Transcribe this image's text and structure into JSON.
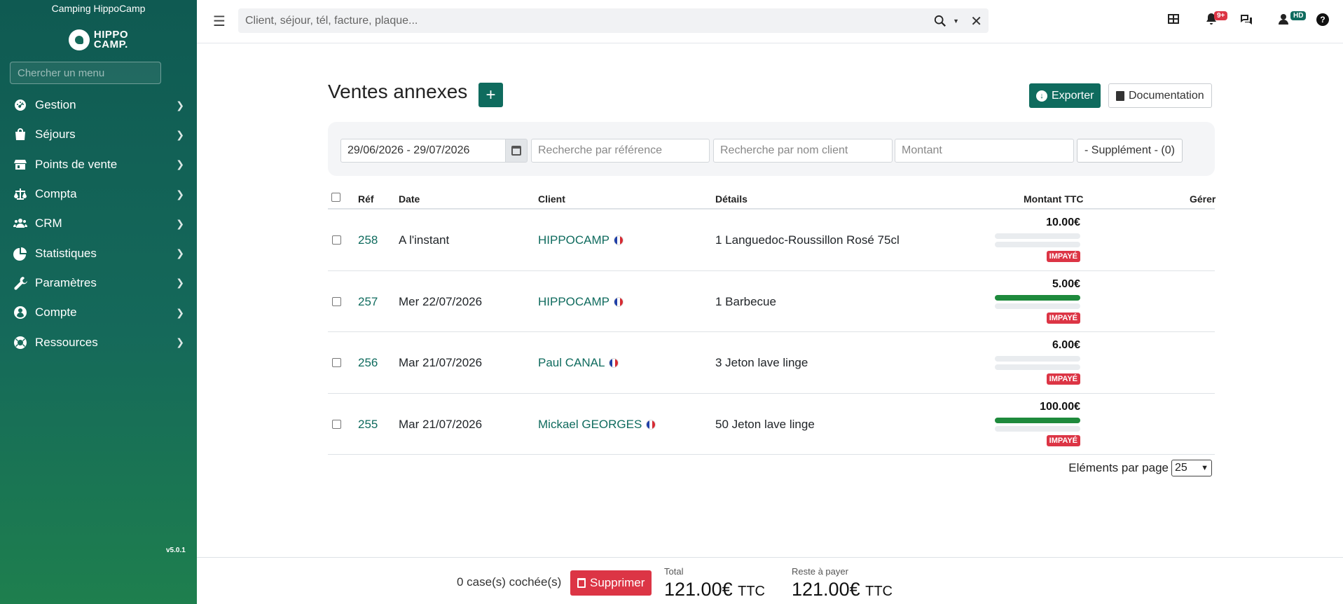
{
  "sidebar": {
    "camp_name": "Camping HippoCamp",
    "logo_text_1": "HIPPO",
    "logo_text_2": "CAMP.",
    "search_placeholder": "Chercher un menu",
    "items": [
      {
        "label": "Gestion",
        "icon": "gauge-icon"
      },
      {
        "label": "Séjours",
        "icon": "bag-icon"
      },
      {
        "label": "Points de vente",
        "icon": "store-icon"
      },
      {
        "label": "Compta",
        "icon": "scale-icon"
      },
      {
        "label": "CRM",
        "icon": "users-icon"
      },
      {
        "label": "Statistiques",
        "icon": "pie-chart-icon"
      },
      {
        "label": "Paramètres",
        "icon": "wrench-icon"
      },
      {
        "label": "Compte",
        "icon": "user-circle-icon"
      },
      {
        "label": "Ressources",
        "icon": "lifebuoy-icon"
      }
    ],
    "version": "v5.0.1"
  },
  "topbar": {
    "search_placeholder": "Client, séjour, tél, facture, plaque...",
    "notifications_badge": "9+",
    "user_initials": "HD",
    "help": "?"
  },
  "page": {
    "title": "Ventes annexes",
    "add_label": "+",
    "export_label": "Exporter",
    "documentation_label": "Documentation"
  },
  "filters": {
    "date_range": "29/06/2026 - 29/07/2026",
    "ref_placeholder": "Recherche par référence",
    "client_placeholder": "Recherche par nom client",
    "amount_placeholder": "Montant",
    "supplement_label": "- Supplément - (0)"
  },
  "table": {
    "headers": {
      "ref": "Réf",
      "date": "Date",
      "client": "Client",
      "details": "Détails",
      "amount": "Montant TTC",
      "manage": "Gérer"
    },
    "rows": [
      {
        "ref": "258",
        "date": "A l'instant",
        "client": "HIPPOCAMP",
        "details": "1 Languedoc-Roussillon Rosé 75cl",
        "amount": "10.00€",
        "paid_fraction": 0,
        "status": "IMPAYÉ"
      },
      {
        "ref": "257",
        "date": "Mer 22/07/2026",
        "client": "HIPPOCAMP",
        "details": "1 Barbecue",
        "amount": "5.00€",
        "paid_fraction": 1,
        "status": "IMPAYÉ"
      },
      {
        "ref": "256",
        "date": "Mar 21/07/2026",
        "client": "Paul CANAL",
        "details": "3 Jeton lave linge",
        "amount": "6.00€",
        "paid_fraction": 0,
        "status": "IMPAYÉ"
      },
      {
        "ref": "255",
        "date": "Mar 21/07/2026",
        "client": "Mickael GEORGES",
        "details": "50 Jeton lave linge",
        "amount": "100.00€",
        "paid_fraction": 1,
        "status": "IMPAYÉ"
      }
    ],
    "per_page_label": "Eléments par page",
    "per_page_value": "25"
  },
  "footer": {
    "checked_count": "0 case(s) cochée(s)",
    "delete_label": "Supprimer",
    "total_label": "Total",
    "total_value": "121.00€",
    "total_unit": "TTC",
    "remaining_label": "Reste à payer",
    "remaining_value": "121.00€",
    "remaining_unit": "TTC"
  },
  "colors": {
    "brand": "#0f6b5e",
    "danger": "#dc3545",
    "success": "#1e8a3c"
  }
}
